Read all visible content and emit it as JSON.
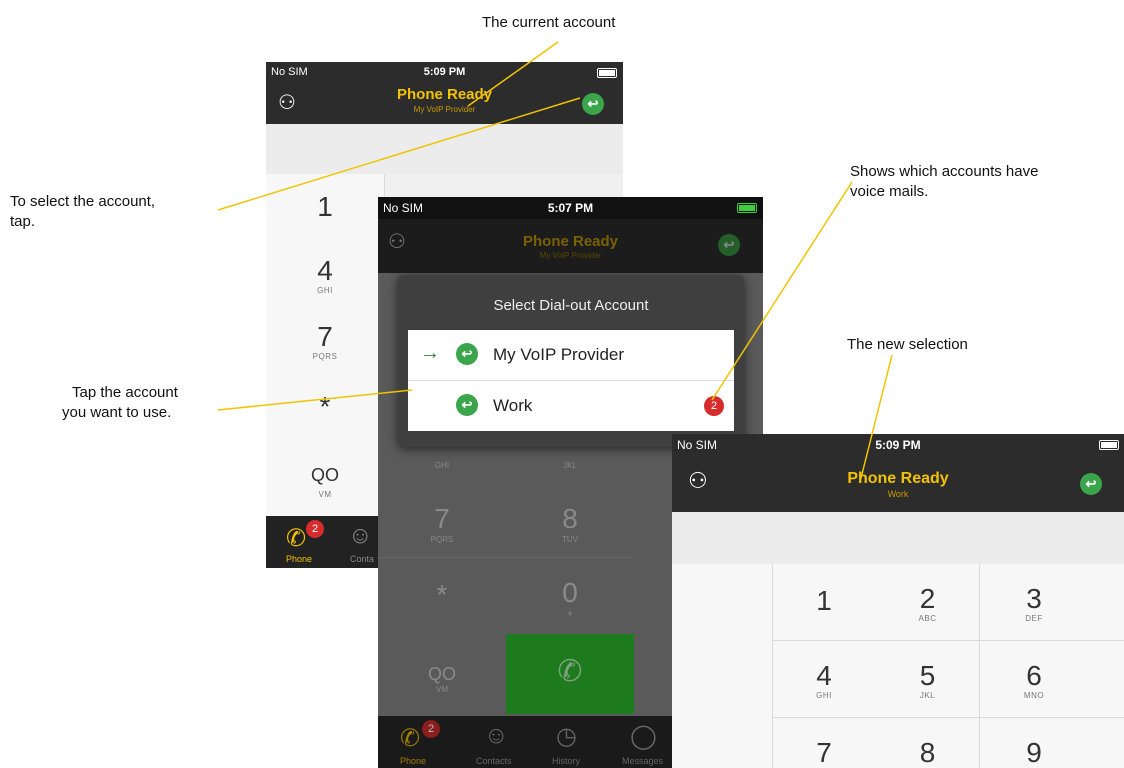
{
  "callouts": {
    "current_account": "The current account",
    "select_account_line1": "To select the account,",
    "select_account_line2": "tap.",
    "voicemail_line1": "Shows which accounts have",
    "voicemail_line2": "voice mails.",
    "tap_account_line1": "Tap the account",
    "tap_account_line2": "you want to use.",
    "new_selection": "The new selection"
  },
  "screen1": {
    "carrier": "No SIM",
    "time": "5:09 PM",
    "title": "Phone Ready",
    "subtitle": "My VoIP Provider",
    "tab_phone": "Phone",
    "tab_contacts": "Conta",
    "badge": "2",
    "keys": [
      {
        "digit": "1",
        "letters": ""
      },
      {
        "digit": "4",
        "letters": "GHI"
      },
      {
        "digit": "7",
        "letters": "PQRS"
      },
      {
        "digit": "*",
        "letters": ""
      },
      {
        "digit": "QO",
        "letters": "VM"
      }
    ]
  },
  "screen2": {
    "carrier": "No SIM",
    "time": "5:07 PM",
    "title": "Phone Ready",
    "subtitle": "My VoIP Provider",
    "dialog_title": "Select Dial-out Account",
    "accounts": [
      {
        "name": "My VoIP Provider",
        "selected": true
      },
      {
        "name": "Work",
        "voicemail_count": "2"
      }
    ],
    "keys_partial": {
      "k4": "GHI",
      "k5": "JKL",
      "d7": "7",
      "l7": "PQRS",
      "d8": "8",
      "l8": "TUV",
      "dstar": "*",
      "d0": "0",
      "l0": "+",
      "vm": "VM"
    },
    "tabs": [
      "Phone",
      "Contacts",
      "History",
      "Messages"
    ],
    "badge": "2"
  },
  "screen3": {
    "carrier": "No SIM",
    "time": "5:09 PM",
    "title": "Phone Ready",
    "subtitle": "Work",
    "keys": [
      {
        "digit": "1",
        "letters": ""
      },
      {
        "digit": "2",
        "letters": "ABC"
      },
      {
        "digit": "3",
        "letters": "DEF"
      },
      {
        "digit": "4",
        "letters": "GHI"
      },
      {
        "digit": "5",
        "letters": "JKL"
      },
      {
        "digit": "6",
        "letters": "MNO"
      },
      {
        "digit": "7",
        "letters": ""
      },
      {
        "digit": "8",
        "letters": ""
      },
      {
        "digit": "9",
        "letters": ""
      }
    ]
  },
  "colors": {
    "accent_yellow": "#f2c300",
    "green": "#3aa54a",
    "badge_red": "#d72c2c",
    "callout_line": "#f0c400"
  }
}
